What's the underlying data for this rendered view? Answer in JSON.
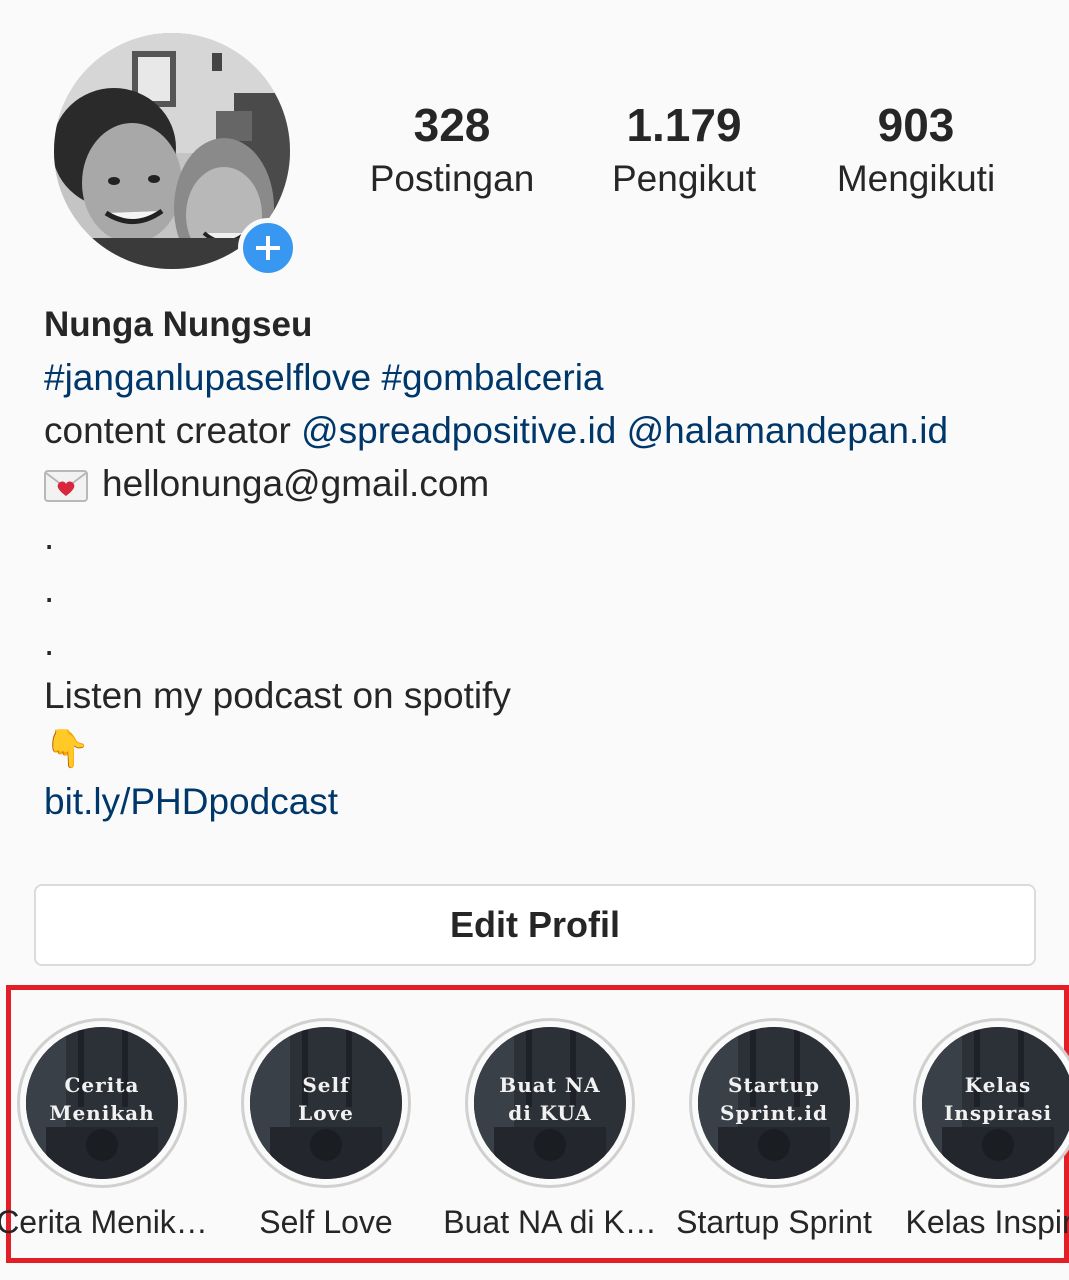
{
  "profile": {
    "name": "Nunga Nungseu",
    "stats": {
      "posts": {
        "count": "328",
        "label": "Postingan"
      },
      "followers": {
        "count": "1.179",
        "label": "Pengikut"
      },
      "following": {
        "count": "903",
        "label": "Mengikuti"
      }
    },
    "bio": {
      "hashtag1": "#janganlupaselflove",
      "hashtag2": "#gombalceria",
      "role_text": "content creator",
      "mention1": "@spreadpositive.id",
      "mention2": "@halamandepan.id",
      "email": "hellonunga@gmail.com",
      "dot": ".",
      "podcast_text": "Listen my podcast on spotify",
      "pointing_emoji": "👇",
      "podcast_link": "bit.ly/PHDpodcast"
    },
    "edit_button_label": "Edit Profil"
  },
  "highlights": [
    {
      "cover_line1": "Cerita",
      "cover_line2": "Menikah",
      "label": "Cerita Menik…"
    },
    {
      "cover_line1": "Self",
      "cover_line2": "Love",
      "label": "Self Love"
    },
    {
      "cover_line1": "Buat NA",
      "cover_line2": "di KUA",
      "label": "Buat NA di K…"
    },
    {
      "cover_line1": "Startup",
      "cover_line2": "Sprint.id",
      "label": "Startup Sprint"
    },
    {
      "cover_line1": "Kelas",
      "cover_line2": "Inspirasi",
      "label": "Kelas Inspira"
    }
  ],
  "colors": {
    "link": "#00376b",
    "add_button": "#3897f0",
    "annotation_frame": "#e21f26"
  },
  "icons": {
    "add_story": "plus-icon",
    "email": "love-letter-envelope-icon"
  }
}
